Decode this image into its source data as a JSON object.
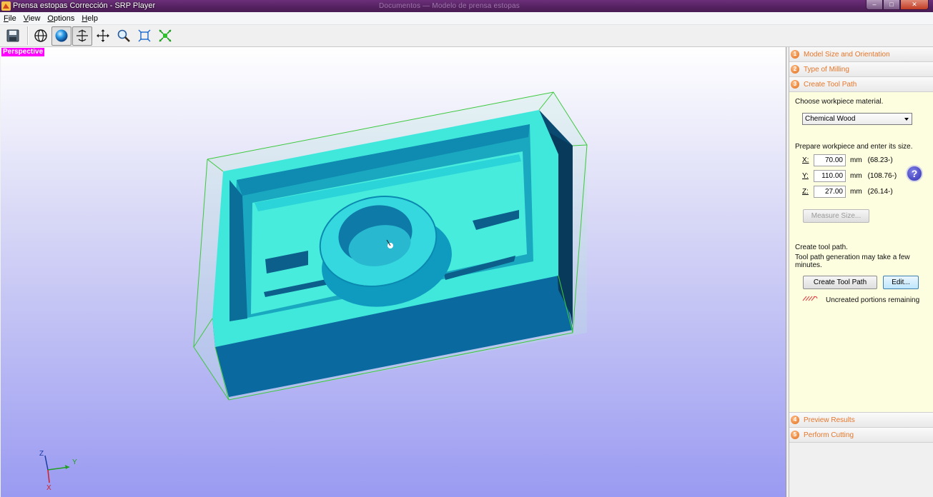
{
  "window": {
    "title": "Prensa estopas Corrección - SRP Player",
    "ghost_title": "Documentos — Modelo de prensa estopas",
    "min_glyph": "–",
    "max_glyph": "□",
    "close_glyph": "✕"
  },
  "menu": [
    "File",
    "View",
    "Options",
    "Help"
  ],
  "toolbar": {
    "buttons": [
      "save-icon",
      "globe-icon",
      "sphere-render-icon",
      "rotate-icon",
      "pan-icon",
      "zoom-icon",
      "fit-icon",
      "zoom-extents-icon"
    ],
    "pressed": [
      "sphere-render-icon",
      "rotate-icon"
    ]
  },
  "viewport": {
    "view_label": "Perspective",
    "triad": {
      "z": "Z",
      "y": "Y",
      "x": "X"
    }
  },
  "panel": {
    "steps": [
      {
        "num": "1",
        "label": "Model Size and Orientation"
      },
      {
        "num": "2",
        "label": "Type of Milling"
      },
      {
        "num": "3",
        "label": "Create Tool Path"
      },
      {
        "num": "4",
        "label": "Preview Results"
      },
      {
        "num": "5",
        "label": "Perform Cutting"
      }
    ],
    "material_prompt": "Choose workpiece material.",
    "material_value": "Chemical Wood",
    "size_prompt": "Prepare workpiece and enter its size.",
    "sizes": [
      {
        "axis": "X:",
        "value": "70.00",
        "unit": "mm",
        "range": "(68.23-)"
      },
      {
        "axis": "Y:",
        "value": "110.00",
        "unit": "mm",
        "range": "(108.76-)"
      },
      {
        "axis": "Z:",
        "value": "27.00",
        "unit": "mm",
        "range": "(26.14-)"
      }
    ],
    "help_glyph": "?",
    "measure_button": "Measure Size...",
    "toolpath_heading": "Create tool path.",
    "toolpath_note": "Tool path generation may take a few minutes.",
    "create_button": "Create Tool Path",
    "edit_button": "Edit...",
    "legend_text": "Uncreated portions remaining"
  },
  "colors": {
    "title_bar": "#54215f",
    "step_label": "#e7762a",
    "panel_body": "#fdfde0",
    "model_top": "#40e8dc",
    "model_side": "#0a6aa0",
    "stock_outline": "#3cc83c"
  }
}
